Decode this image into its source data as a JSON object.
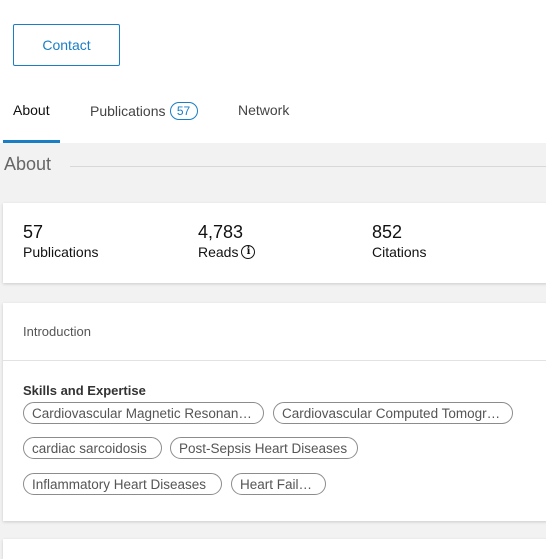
{
  "header": {
    "contact_label": "Contact"
  },
  "tabs": [
    {
      "label": "About"
    },
    {
      "label": "Publications",
      "badge": "57"
    },
    {
      "label": "Network"
    }
  ],
  "section": {
    "title": "About"
  },
  "stats": [
    {
      "value": "57",
      "label": "Publications"
    },
    {
      "value": "4,783",
      "label": "Reads",
      "icon": "info-icon"
    },
    {
      "value": "852",
      "label": "Citations"
    }
  ],
  "intro": {
    "title": "Introduction",
    "skills_heading": "Skills and Expertise",
    "skills": [
      "Cardiovascular Magnetic Resonan…",
      "Cardiovascular Computed Tomogr…",
      "cardiac sarcoidosis",
      "Post-Sepsis Heart Diseases",
      "Inflammatory Heart Diseases",
      "Heart Failure"
    ]
  },
  "colors": {
    "accent": "#1a7ec5",
    "background": "#f2f2f2"
  }
}
